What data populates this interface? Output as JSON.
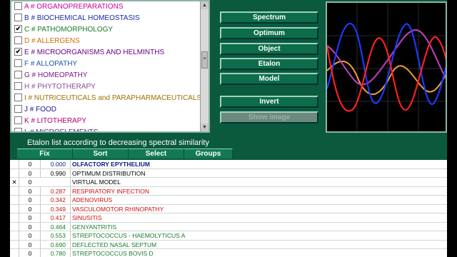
{
  "categories": [
    {
      "label": "A # ORGANOPREPARATIONS",
      "checked": false,
      "color": "#cc0099"
    },
    {
      "label": "B # BIOCHEMICAL HOMEOSTASIS",
      "checked": false,
      "color": "#1a2aa6"
    },
    {
      "label": "C # PATHOMORPHOLOGY",
      "checked": true,
      "color": "#1a7a2a"
    },
    {
      "label": "D # ALLERGENS",
      "checked": false,
      "color": "#d06a00"
    },
    {
      "label": "E # MICROORGANISMS AND HELMINTHS",
      "checked": true,
      "color": "#6a008a"
    },
    {
      "label": "F # ALLOPATHY",
      "checked": false,
      "color": "#1a5aaa"
    },
    {
      "label": "G # HOMEOPATHY",
      "checked": false,
      "color": "#7a1a8a"
    },
    {
      "label": "H # PHYTOTHERAPY",
      "checked": false,
      "color": "#8a4a9a"
    },
    {
      "label": "I # NUTRICEUTICALS and PARAPHARMACEUTICALS",
      "checked": false,
      "color": "#a07000"
    },
    {
      "label": "J # FOOD",
      "checked": false,
      "color": "#1a1a8a"
    },
    {
      "label": "K # LITOTHERAPY",
      "checked": false,
      "color": "#b00070"
    },
    {
      "label": "L # MICROELEMENTS",
      "checked": false,
      "color": "#5a1a8a"
    }
  ],
  "buttons": {
    "spectrum": "Spectrum",
    "optimum": "Optimum",
    "object": "Object",
    "etalon": "Etalon",
    "model": "Model",
    "invert": "Invert",
    "show_image": "Show image"
  },
  "etalon_title": "Etalon list according to decreasing spectral similarity",
  "toolbar": {
    "fix": "Fix",
    "sort": "Sort",
    "select": "Select",
    "groups": "Groups"
  },
  "rows": [
    {
      "mark": "",
      "n": "0",
      "value": "0.000",
      "name": "OLFACTORY EPYTHELIUM",
      "color": "#0a1a8a",
      "bold": true
    },
    {
      "mark": "",
      "n": "0",
      "value": "0.990",
      "name": "OPTIMUM DISTRIBUTION",
      "color": "#000000",
      "bold": false
    },
    {
      "mark": "✕",
      "n": "0",
      "value": "",
      "name": "VIRTUAL MODEL",
      "color": "#000000",
      "bold": false
    },
    {
      "mark": "",
      "n": "0",
      "value": "0.287",
      "name": "RESPIRATORY  INFECTION",
      "color": "#cc1010",
      "bold": false
    },
    {
      "mark": "",
      "n": "0",
      "value": "0.342",
      "name": "ADENOVIRUS",
      "color": "#cc1010",
      "bold": false
    },
    {
      "mark": "",
      "n": "0",
      "value": "0.349",
      "name": "VASCULOMOTOR  RHINOPATHY",
      "color": "#cc1010",
      "bold": false
    },
    {
      "mark": "",
      "n": "0",
      "value": "0.417",
      "name": "SINUSITIS",
      "color": "#cc1010",
      "bold": false
    },
    {
      "mark": "",
      "n": "0",
      "value": "0.464",
      "name": "GENYANTRITIS",
      "color": "#1a7a2a",
      "bold": false
    },
    {
      "mark": "",
      "n": "0",
      "value": "0.553",
      "name": "STREPTOCOCCUS - HAEMOLYTICUS  A",
      "color": "#1a7a2a",
      "bold": false
    },
    {
      "mark": "",
      "n": "0",
      "value": "0.690",
      "name": "DEFLECTED NASAL SEPTUM",
      "color": "#1a7a2a",
      "bold": false
    },
    {
      "mark": "",
      "n": "0",
      "value": "0.780",
      "name": "STREPTOCOCCUS BOVIS D",
      "color": "#1a7a2a",
      "bold": false
    }
  ]
}
